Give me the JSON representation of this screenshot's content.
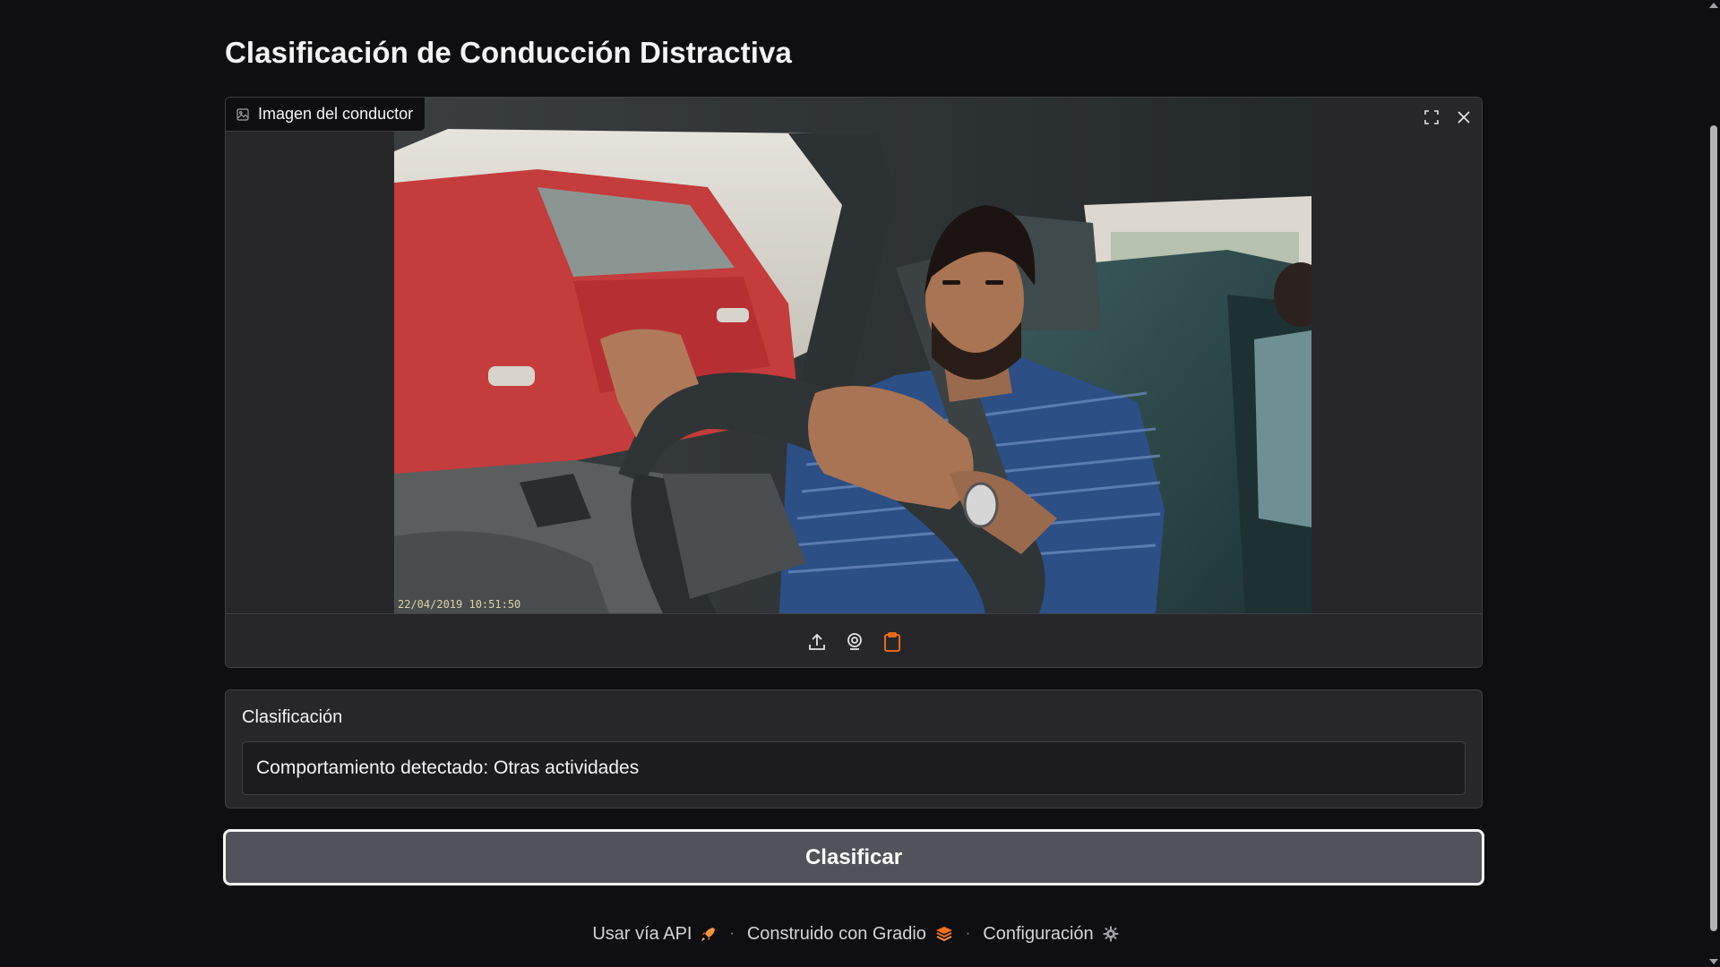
{
  "page": {
    "title": "Clasificación de Conducción Distractiva"
  },
  "image_input": {
    "label": "Imagen del conductor",
    "label_icon": "image-icon",
    "timestamp": "22/04/2019 10:51:50",
    "tools": [
      {
        "name": "fullscreen",
        "icon": "fullscreen-icon"
      },
      {
        "name": "clear",
        "icon": "close-icon"
      }
    ],
    "sources": [
      {
        "name": "upload",
        "icon": "upload-icon"
      },
      {
        "name": "webcam",
        "icon": "webcam-icon"
      },
      {
        "name": "clipboard",
        "icon": "clipboard-icon",
        "active": true
      }
    ],
    "accent_color": "#f97316"
  },
  "output": {
    "label": "Clasificación",
    "value": "Comportamiento detectado: Otras actividades"
  },
  "actions": {
    "classify_label": "Clasificar"
  },
  "footer": {
    "api_label": "Usar vía API",
    "built_label": "Construido con Gradio",
    "settings_label": "Configuración",
    "separator": "·"
  }
}
